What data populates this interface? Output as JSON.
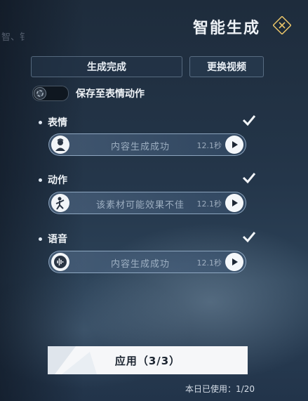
{
  "header": {
    "title": "智能生成"
  },
  "background": {
    "glyphs": "智、钅"
  },
  "tabs": {
    "generated": "生成完成",
    "change_video": "更换视频"
  },
  "save_option": {
    "label": "保存至表情动作",
    "enabled": false
  },
  "sections": [
    {
      "label": "表情",
      "checked": true,
      "icon": "face-avatar-icon",
      "status": "内容生成成功",
      "duration": "12.1秒"
    },
    {
      "label": "动作",
      "checked": true,
      "icon": "body-pose-icon",
      "status": "该素材可能效果不佳",
      "duration": "12.1秒"
    },
    {
      "label": "语音",
      "checked": true,
      "icon": "audio-wave-icon",
      "status": "内容生成成功",
      "duration": "12.1秒"
    }
  ],
  "apply_button": {
    "label": "应用（3/3）"
  },
  "usage": {
    "text": "本日已使用：1/20"
  },
  "colors": {
    "panel_border": "#9fb4c8",
    "button_bg": "#f6f7f9",
    "accent_icon": "#e8c46a"
  }
}
